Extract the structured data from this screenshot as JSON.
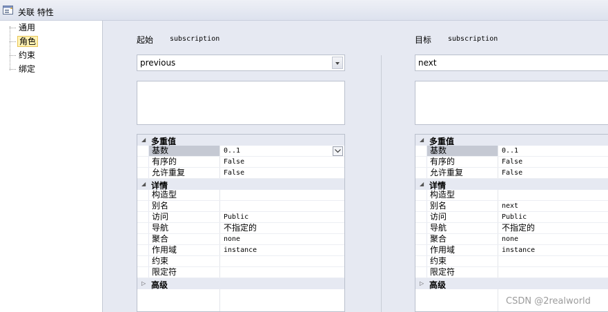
{
  "window": {
    "title": "关联 特性",
    "icon": "properties-window-icon"
  },
  "tree": {
    "items": [
      {
        "label": "通用",
        "selected": false
      },
      {
        "label": "角色",
        "selected": true
      },
      {
        "label": "约束",
        "selected": false
      },
      {
        "label": "绑定",
        "selected": false
      }
    ]
  },
  "source": {
    "header_label": "起始",
    "header_value": "subscription",
    "role_name": "previous",
    "notes": "",
    "properties": {
      "multiplicity_group": {
        "label": "多重值",
        "rows": [
          {
            "name": "基数",
            "value": "0..1"
          },
          {
            "name": "有序的",
            "value": "False"
          },
          {
            "name": "允许重复",
            "value": "False"
          }
        ]
      },
      "details_group": {
        "label": "详情",
        "rows": [
          {
            "name": "构造型",
            "value": ""
          },
          {
            "name": "别名",
            "value": ""
          },
          {
            "name": "访问",
            "value": "Public"
          },
          {
            "name": "导航",
            "value": "不指定的"
          },
          {
            "name": "聚合",
            "value": "none"
          },
          {
            "name": "作用域",
            "value": "instance"
          },
          {
            "name": "约束",
            "value": ""
          },
          {
            "name": "限定符",
            "value": ""
          }
        ]
      },
      "advanced_group": {
        "label": "高级"
      }
    }
  },
  "target": {
    "header_label": "目标",
    "header_value": "subscription",
    "role_name": "next",
    "notes": "",
    "properties": {
      "multiplicity_group": {
        "label": "多重值",
        "rows": [
          {
            "name": "基数",
            "value": "0..1"
          },
          {
            "name": "有序的",
            "value": "False"
          },
          {
            "name": "允许重复",
            "value": "False"
          }
        ]
      },
      "details_group": {
        "label": "详情",
        "rows": [
          {
            "name": "构造型",
            "value": ""
          },
          {
            "name": "别名",
            "value": "next"
          },
          {
            "name": "访问",
            "value": "Public"
          },
          {
            "name": "导航",
            "value": "不指定的"
          },
          {
            "name": "聚合",
            "value": "none"
          },
          {
            "name": "作用域",
            "value": "instance"
          },
          {
            "name": "约束",
            "value": ""
          },
          {
            "name": "限定符",
            "value": ""
          }
        ]
      },
      "advanced_group": {
        "label": "高级"
      }
    }
  },
  "icons": {
    "expanded": "triangle-expanded-icon",
    "collapsed": "triangle-collapsed-icon",
    "dropdown": "chevron-down-icon"
  },
  "watermark": "CSDN @2realworld"
}
